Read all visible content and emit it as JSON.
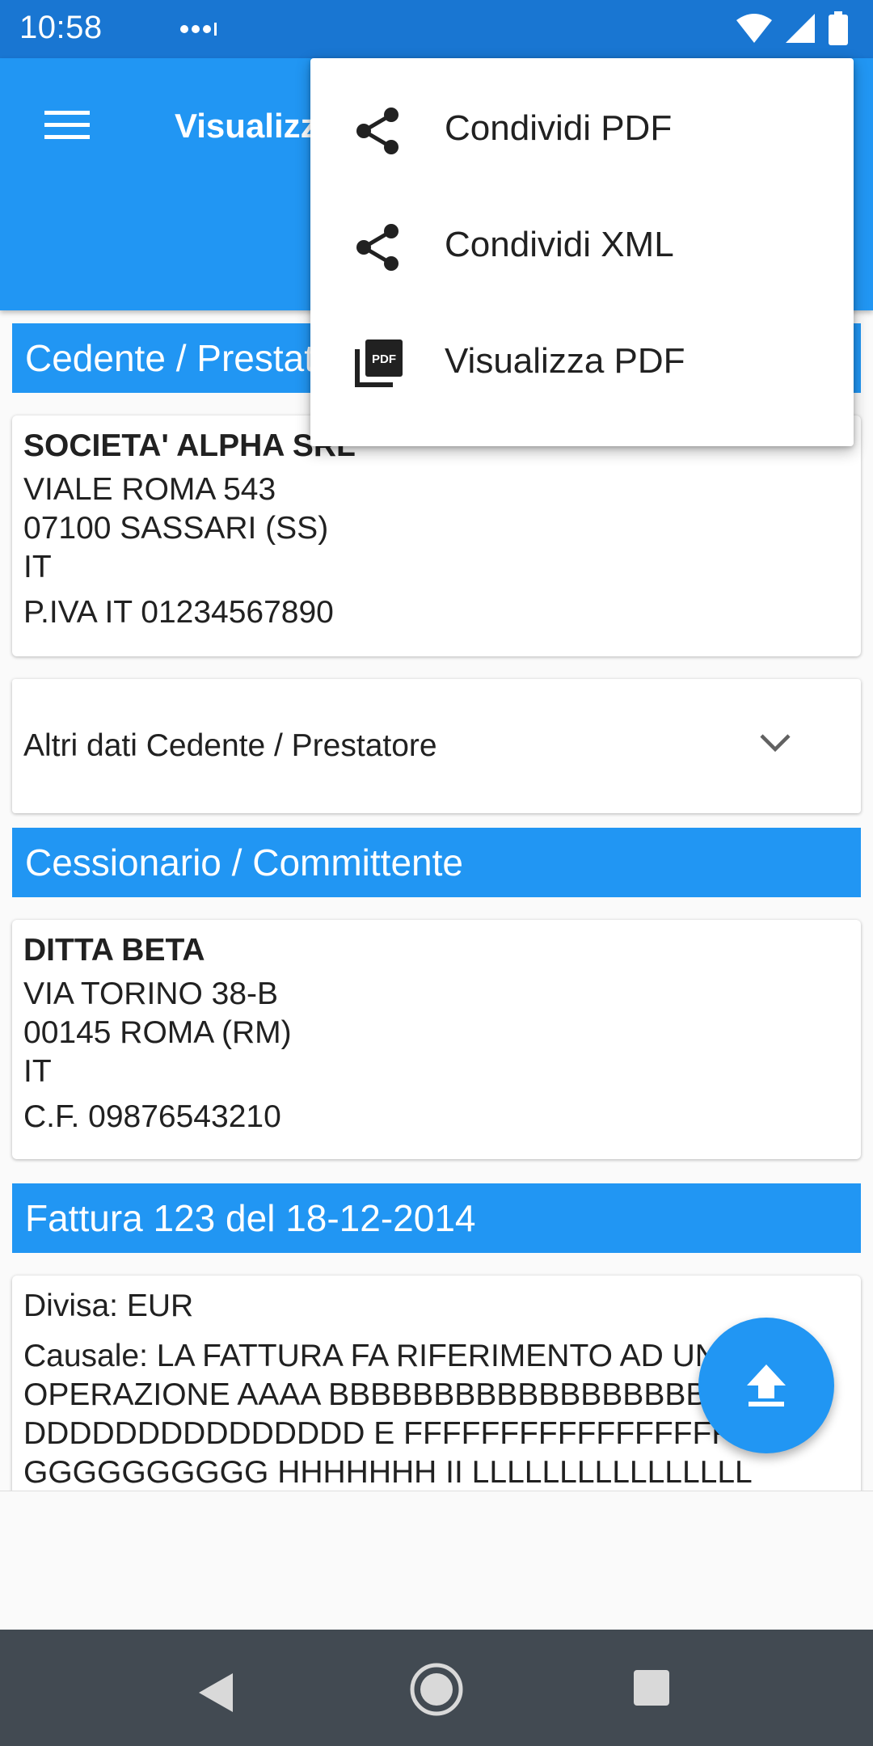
{
  "status_bar": {
    "time": "10:58",
    "icons": [
      "notification-dots-icon",
      "wifi-icon",
      "signal-icon",
      "battery-icon"
    ]
  },
  "app_bar": {
    "title": "Visualizza",
    "menu_icon": "hamburger-menu-icon"
  },
  "menu": {
    "items": [
      {
        "label": "Condividi PDF",
        "icon": "share-icon"
      },
      {
        "label": "Condividi XML",
        "icon": "share-icon"
      },
      {
        "label": "Visualizza PDF",
        "icon": "pdf-icon"
      }
    ]
  },
  "seller": {
    "section_title": "Cedente / Prestatore",
    "name": "SOCIETA' ALPHA SRL",
    "address_line1": "VIALE ROMA 543",
    "address_line2": "07100 SASSARI (SS)",
    "country": "IT",
    "tax_id": "P.IVA IT 01234567890",
    "more_label": "Altri dati Cedente / Prestatore"
  },
  "buyer": {
    "section_title": "Cessionario / Committente",
    "name": "DITTA BETA",
    "address_line1": "VIA TORINO 38-B",
    "address_line2": "00145 ROMA (RM)",
    "country": "IT",
    "tax_id": "C.F. 09876543210"
  },
  "invoice": {
    "section_title": "Fattura 123 del 18-12-2014",
    "currency": "Divisa: EUR",
    "reason_lines": [
      "Causale: LA FATTURA FA RIFERIMENTO AD UNA",
      "OPERAZIONE AAAA BBBBBBBBBBBBBBBBBB CCC",
      "DDDDDDDDDDDDDDD E FFFFFFFFFFFFFFFFFF",
      "GGGGGGGGGG HHHHHHH II LLLLLLLLLLLLLLLL"
    ]
  },
  "fab": {
    "icon": "upload-icon"
  },
  "colors": {
    "primary": "#2196f3",
    "primary_dark": "#1976d2",
    "nav_bar": "#424a52"
  }
}
